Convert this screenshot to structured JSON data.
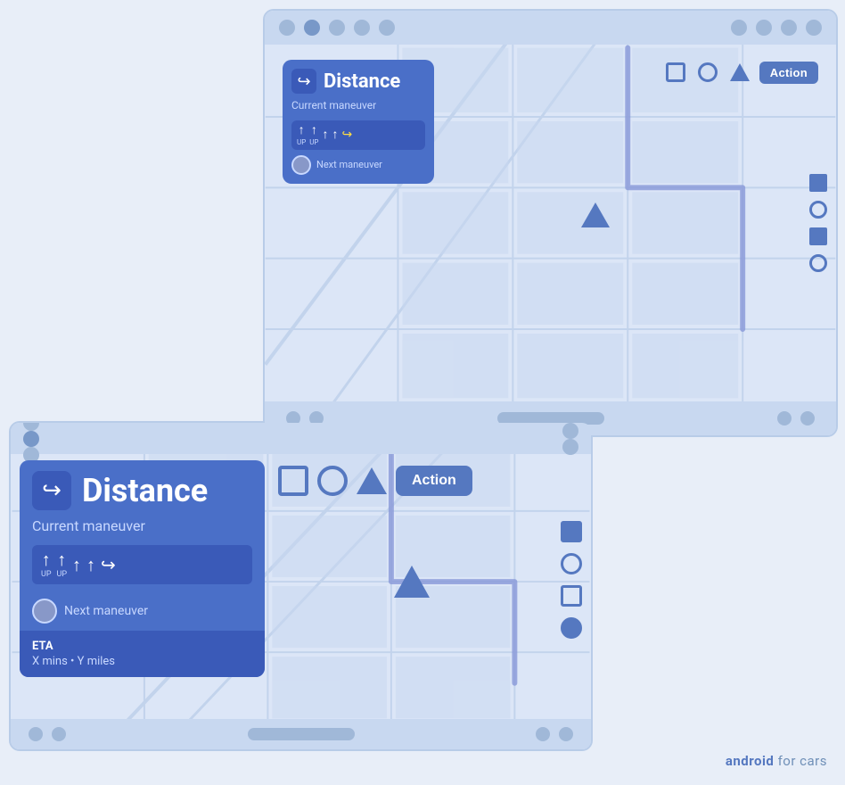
{
  "large_screen": {
    "nav_card": {
      "distance": "Distance",
      "maneuver": "Current maneuver",
      "next_maneuver": "Next maneuver",
      "lanes": [
        {
          "label": "UP",
          "arrow": "↑",
          "highlight": false
        },
        {
          "label": "UP",
          "arrow": "↑",
          "highlight": false
        },
        {
          "label": "",
          "arrow": "↑",
          "highlight": false
        },
        {
          "label": "",
          "arrow": "↑",
          "highlight": false
        },
        {
          "label": "",
          "arrow": "↪",
          "highlight": true
        }
      ]
    },
    "toolbar": {
      "action_label": "Action"
    }
  },
  "small_screen": {
    "nav_card": {
      "distance": "Distance",
      "maneuver": "Current maneuver",
      "next_maneuver": "Next maneuver",
      "lanes": [
        {
          "label": "UP",
          "arrow": "↑",
          "highlight": false
        },
        {
          "label": "UP",
          "arrow": "↑",
          "highlight": false
        },
        {
          "label": "",
          "arrow": "↑",
          "highlight": false
        },
        {
          "label": "",
          "arrow": "↑",
          "highlight": false
        },
        {
          "label": "",
          "arrow": "↪",
          "highlight": true
        }
      ],
      "eta_label": "ETA",
      "eta_value": "X mins • Y miles"
    },
    "toolbar": {
      "action_label": "Action"
    }
  },
  "branding": {
    "text": "android",
    "suffix": " for cars"
  }
}
